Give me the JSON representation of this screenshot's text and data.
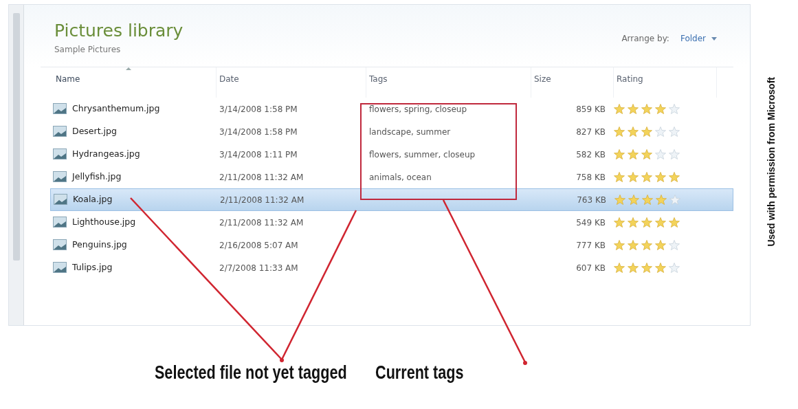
{
  "library": {
    "title": "Pictures library",
    "subtitle": "Sample Pictures",
    "arrange_label": "Arrange by:",
    "arrange_value": "Folder"
  },
  "columns": [
    {
      "label": "Name",
      "sorted": true
    },
    {
      "label": "Date",
      "sorted": false
    },
    {
      "label": "Tags",
      "sorted": false
    },
    {
      "label": "Size",
      "sorted": false
    },
    {
      "label": "Rating",
      "sorted": false
    }
  ],
  "rows": [
    {
      "name": "Chrysanthemum.jpg",
      "date": "3/14/2008 1:58 PM",
      "tags": "flowers, spring, closeup",
      "size": "859 KB",
      "stars": 4,
      "selected": false
    },
    {
      "name": "Desert.jpg",
      "date": "3/14/2008 1:58 PM",
      "tags": "landscape, summer",
      "size": "827 KB",
      "stars": 3,
      "selected": false
    },
    {
      "name": "Hydrangeas.jpg",
      "date": "3/14/2008 1:11 PM",
      "tags": "flowers, summer, closeup",
      "size": "582 KB",
      "stars": 3,
      "selected": false
    },
    {
      "name": "Jellyfish.jpg",
      "date": "2/11/2008 11:32 AM",
      "tags": "animals, ocean",
      "size": "758 KB",
      "stars": 5,
      "selected": false
    },
    {
      "name": "Koala.jpg",
      "date": "2/11/2008 11:32 AM",
      "size": "763 KB",
      "stars": 4,
      "selected": true
    },
    {
      "name": "Lighthouse.jpg",
      "date": "2/11/2008 11:32 AM",
      "size": "549 KB",
      "stars": 5,
      "selected": false
    },
    {
      "name": "Penguins.jpg",
      "date": "2/16/2008 5:07 AM",
      "size": "777 KB",
      "stars": 4,
      "selected": false
    },
    {
      "name": "Tulips.jpg",
      "date": "2/7/2008 11:33 AM",
      "size": "607 KB",
      "stars": 4,
      "selected": false
    }
  ],
  "callouts": [
    "Selected file not yet tagged",
    "Current tags"
  ],
  "credit": "Used with permission from Microsoft"
}
